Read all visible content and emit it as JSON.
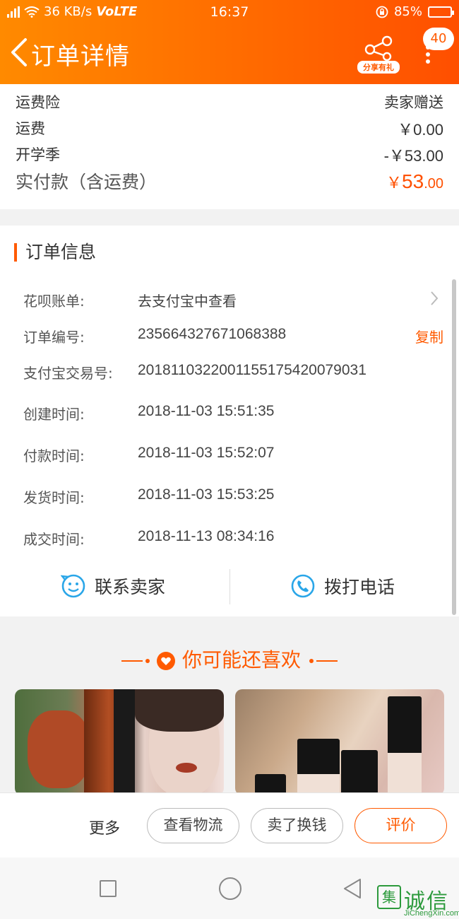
{
  "status_bar": {
    "network": "36 KB/s",
    "volte": "VoLTE",
    "time": "16:37",
    "battery": "85%"
  },
  "nav": {
    "title": "订单详情",
    "share_label": "分享有礼",
    "badge_count": "40"
  },
  "fees": [
    {
      "label": "运费险",
      "value": "卖家赠送"
    },
    {
      "label": "运费",
      "value": "￥0.00"
    },
    {
      "label": "开学季",
      "value": "-￥53.00"
    }
  ],
  "total": {
    "label": "实付款（含运费）",
    "currency": "￥",
    "integer": "53",
    "decimal": ".00"
  },
  "order_info": {
    "title": "订单信息",
    "rows": [
      {
        "label": "花呗账单:",
        "value": "去支付宝中查看"
      },
      {
        "label": "订单编号:",
        "value": "235664327671068388"
      },
      {
        "label": "支付宝交易号:",
        "value": "2018110322001155175420079031"
      },
      {
        "label": "创建时间:",
        "value": "2018-11-03 15:51:35"
      },
      {
        "label": "付款时间:",
        "value": "2018-11-03 15:52:07"
      },
      {
        "label": "发货时间:",
        "value": "2018-11-03 15:53:25"
      },
      {
        "label": "成交时间:",
        "value": "2018-11-13 08:34:16"
      }
    ],
    "copy_label": "复制"
  },
  "contact": {
    "seller_label": "联系卖家",
    "call_label": "拨打电话"
  },
  "recommend": {
    "title": "你可能还喜欢"
  },
  "actions": {
    "more": "更多",
    "logistics": "查看物流",
    "resell": "卖了换钱",
    "review": "评价"
  },
  "watermark": {
    "text": "诚信",
    "box": "集",
    "url": "JiChengXin.com"
  },
  "colors": {
    "accent": "#ff5a00",
    "header_start": "#ff8a00",
    "header_end": "#ff4f00"
  }
}
